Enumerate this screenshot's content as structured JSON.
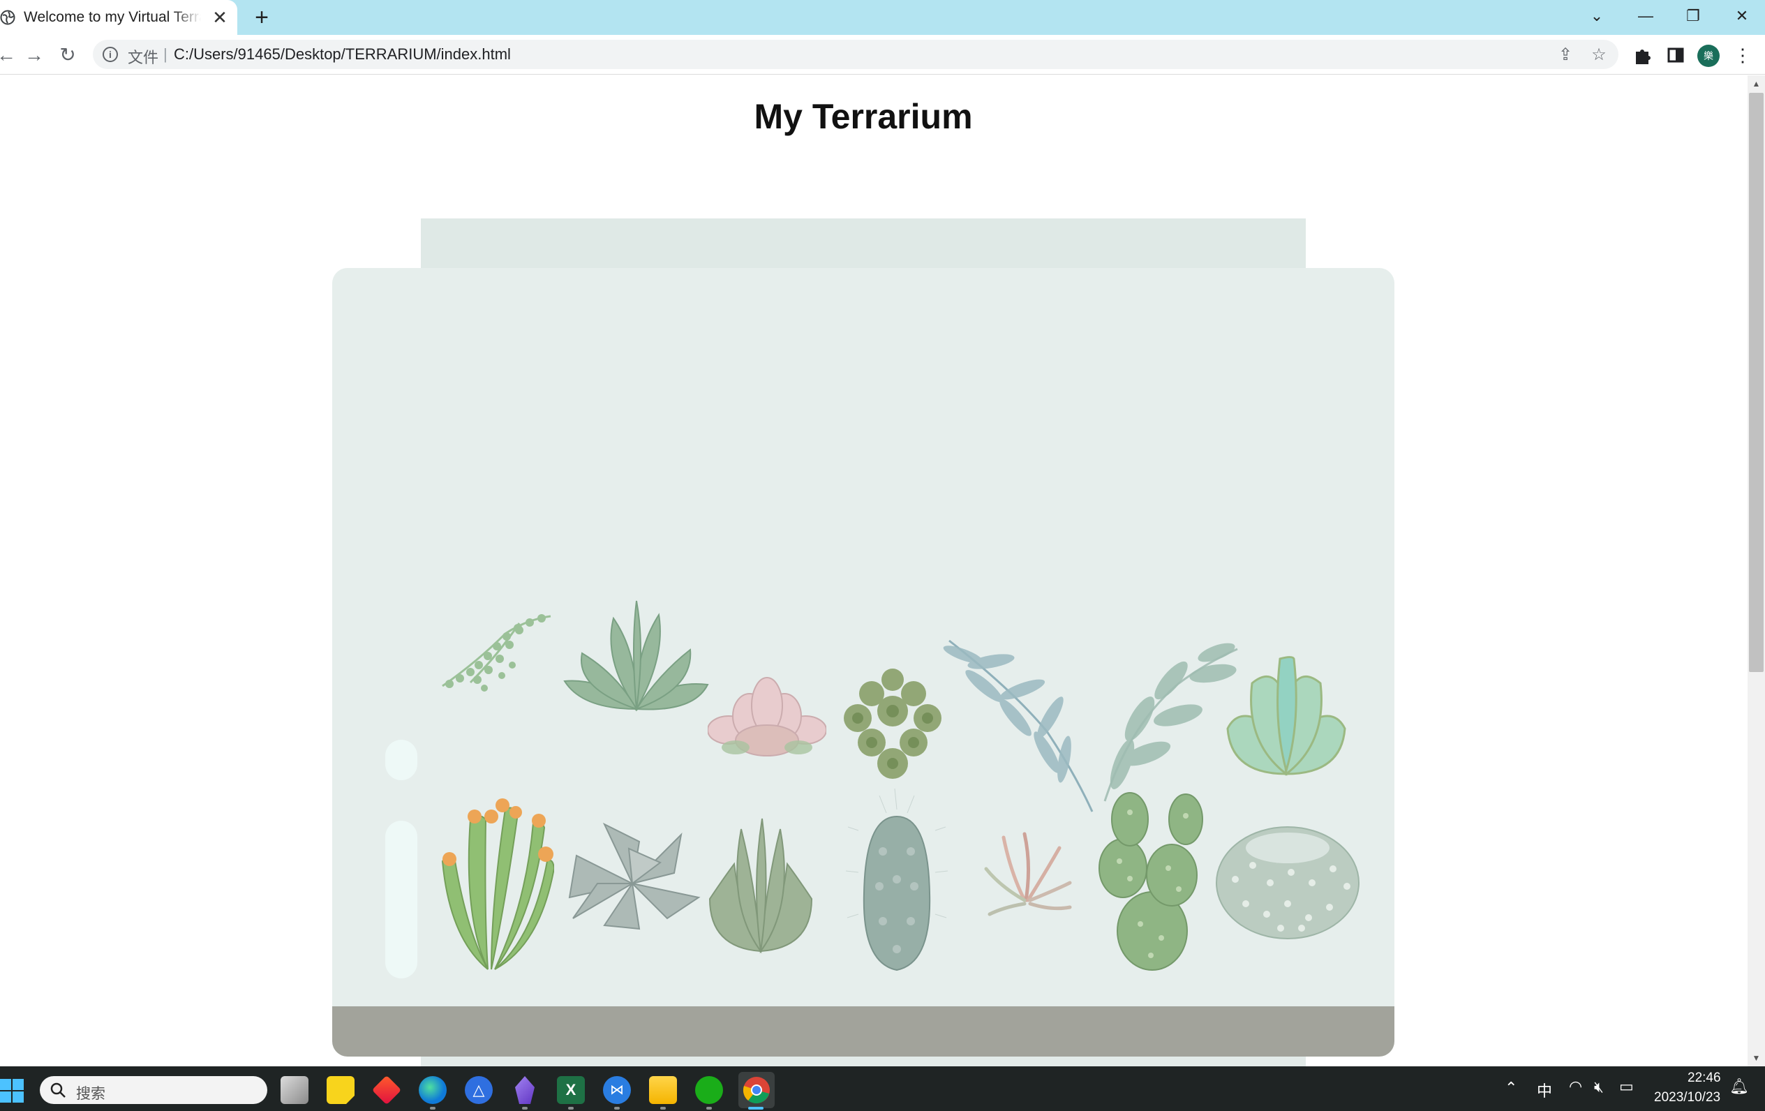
{
  "browser": {
    "tab_title": "Welcome to my Virtual Terrarium",
    "tab_close": "✕",
    "new_tab": "+",
    "omnibox_chip": "文件",
    "omnibox_sep": "|",
    "url": "C:/Users/91465/Desktop/TERRARIUM/index.html",
    "profile_initial": "樂"
  },
  "page": {
    "title": "My Terrarium"
  },
  "plants": [
    "string-of-pearls",
    "green-echeveria",
    "pink-succulent",
    "sedum-cluster",
    "eucalyptus-branch",
    "leafy-branch",
    "jade-succulent",
    "flowering-cactus",
    "gray-succulent",
    "aloe",
    "columnar-cactus",
    "air-plant",
    "prickly-pear",
    "ball-cactus"
  ],
  "taskbar": {
    "search_placeholder": "搜索",
    "ime": "中",
    "time": "22:46",
    "date": "2023/10/23"
  },
  "colors": {
    "tabstrip": "#b3e4f1",
    "jar": "#e6eeec",
    "dirt": "#a2a39b",
    "taskbar": "#1f2424"
  }
}
